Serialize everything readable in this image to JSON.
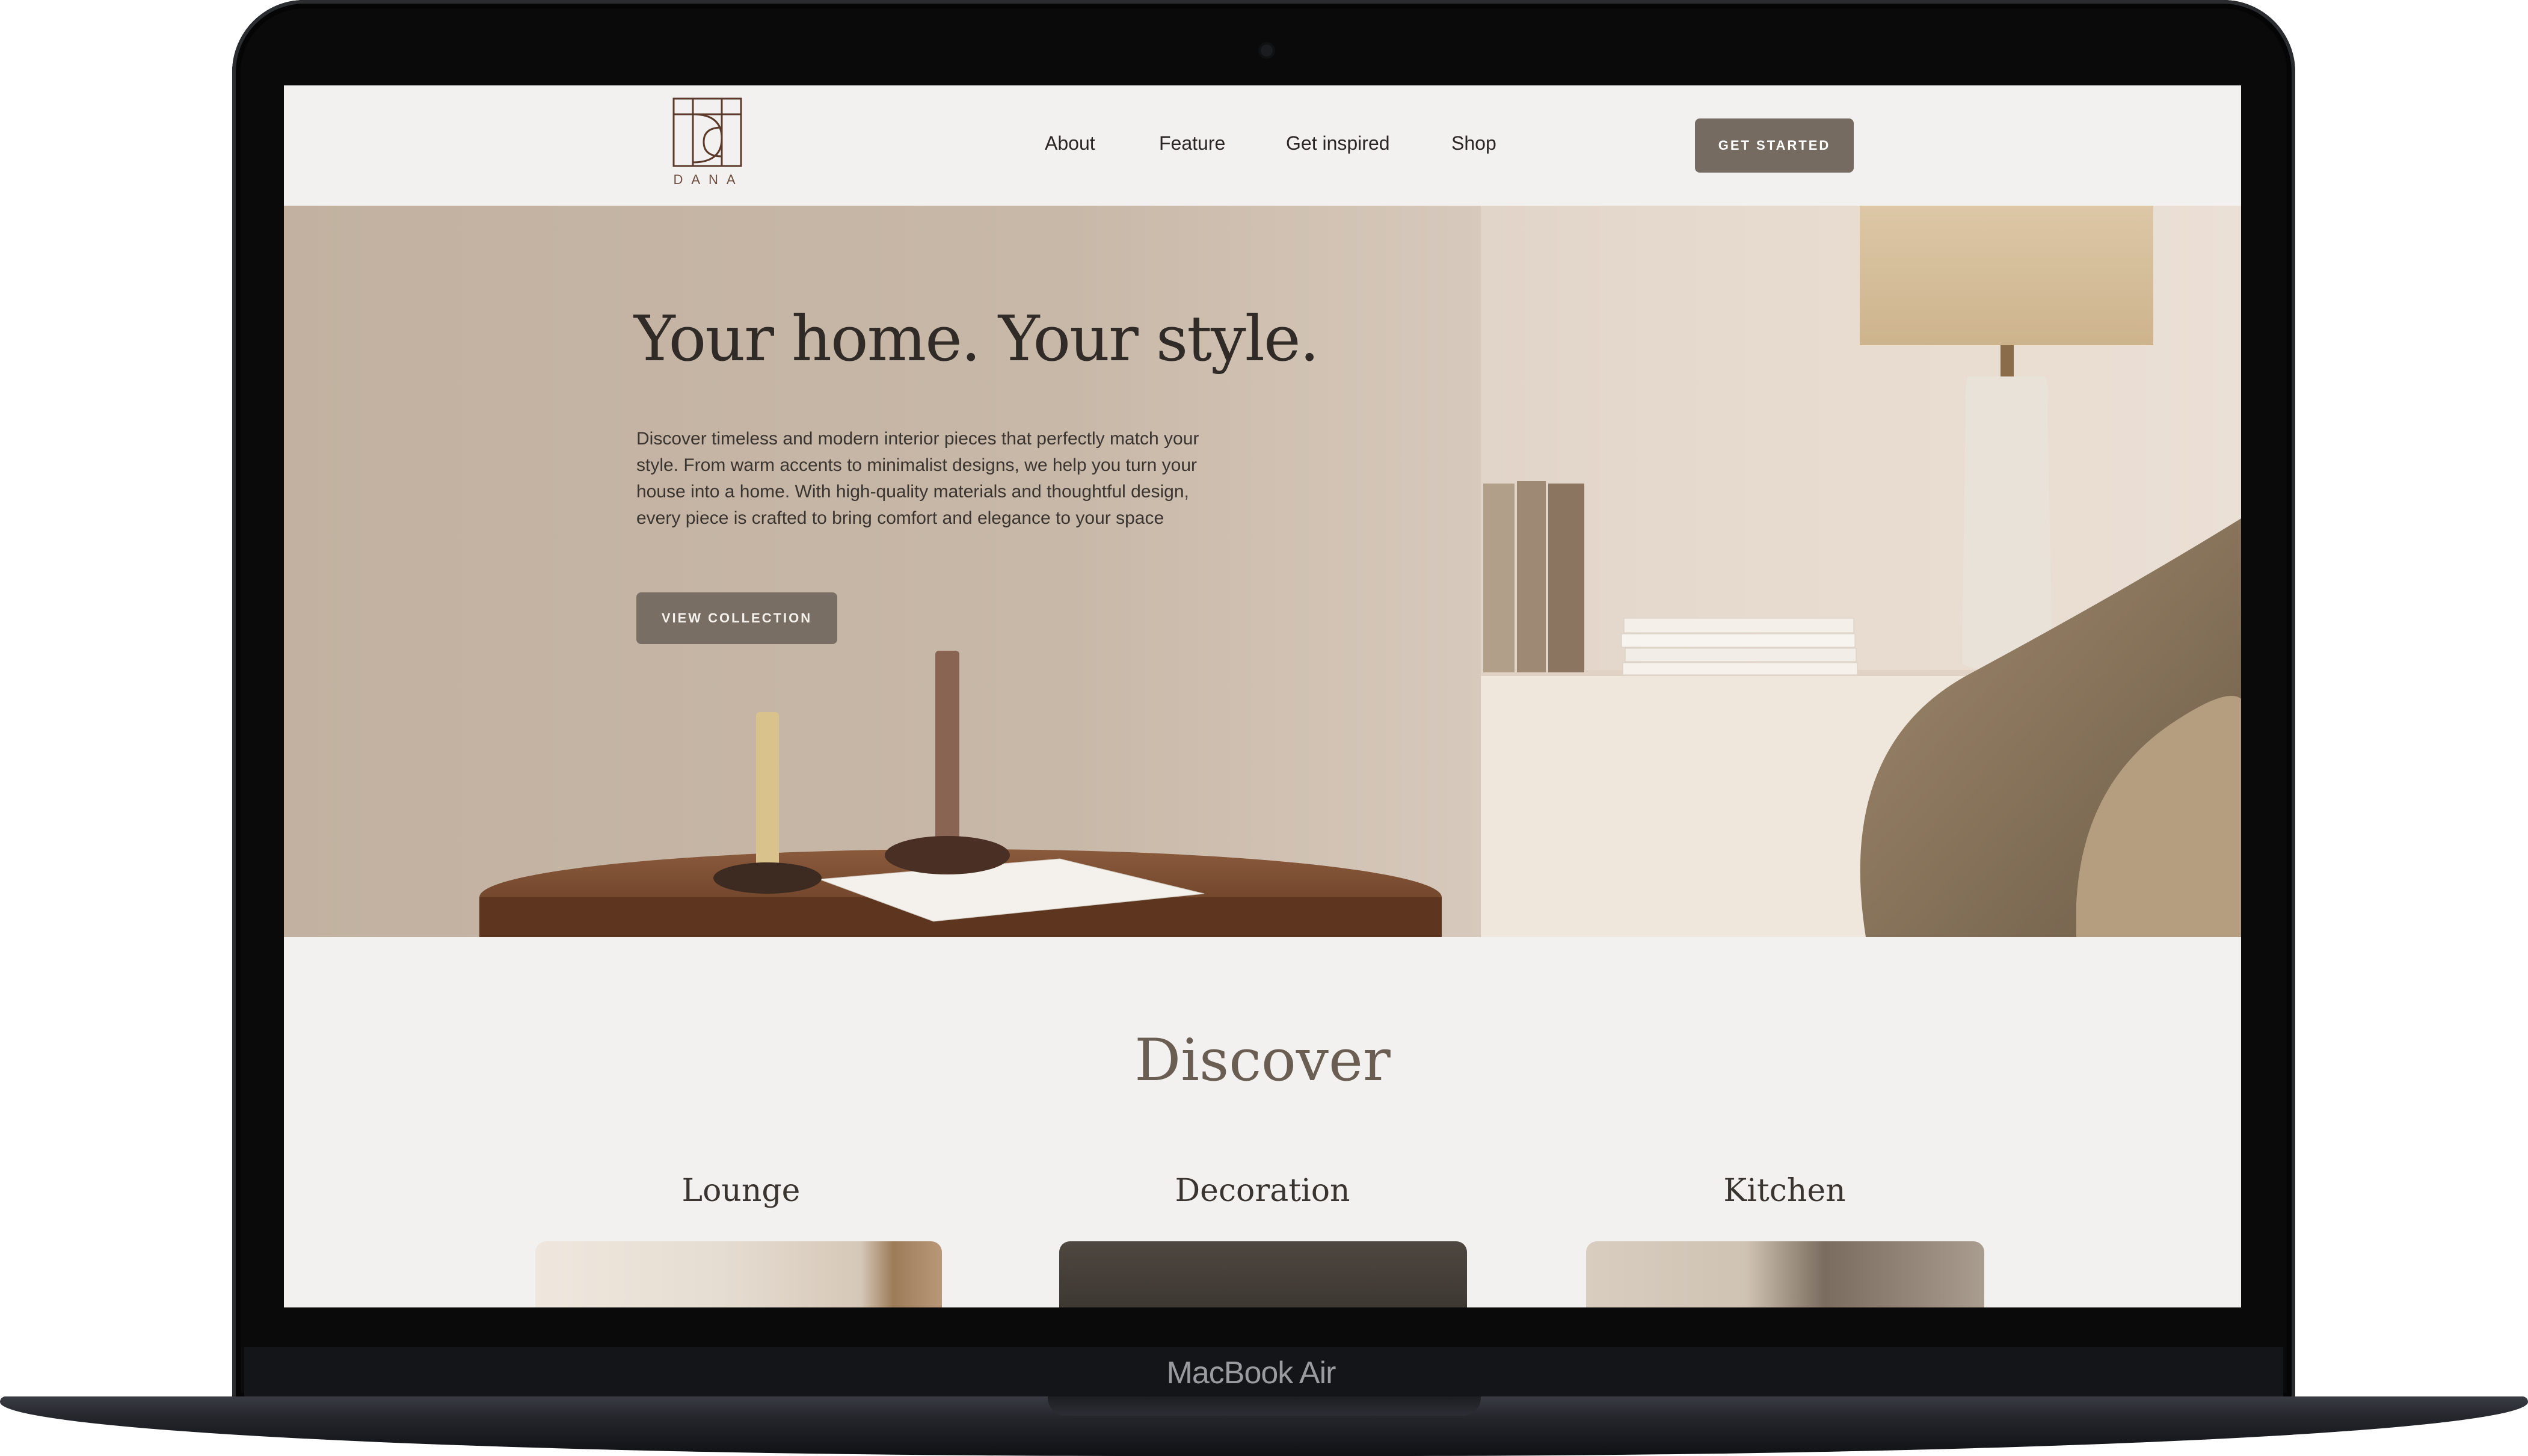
{
  "device": {
    "label": "MacBook Air"
  },
  "nav": {
    "logo_text": "DANA",
    "links": [
      "About",
      "Feature",
      "Get inspired",
      "Shop"
    ],
    "cta": "GET STARTED"
  },
  "hero": {
    "title": "Your home. Your style.",
    "description": "Discover timeless and modern interior pieces that perfectly match your style. From warm accents to minimalist designs, we help you turn your house into a home. With high-quality materials and thoughtful design, every piece is crafted to bring comfort and elegance to your space",
    "button": "VIEW COLLECTION"
  },
  "discover": {
    "title": "Discover",
    "categories": [
      "Lounge",
      "Decoration",
      "Kitchen"
    ]
  },
  "colors": {
    "page_bg": "#f3f1ef",
    "button_bg": "#766b60",
    "accent_text": "#6a5d52"
  }
}
